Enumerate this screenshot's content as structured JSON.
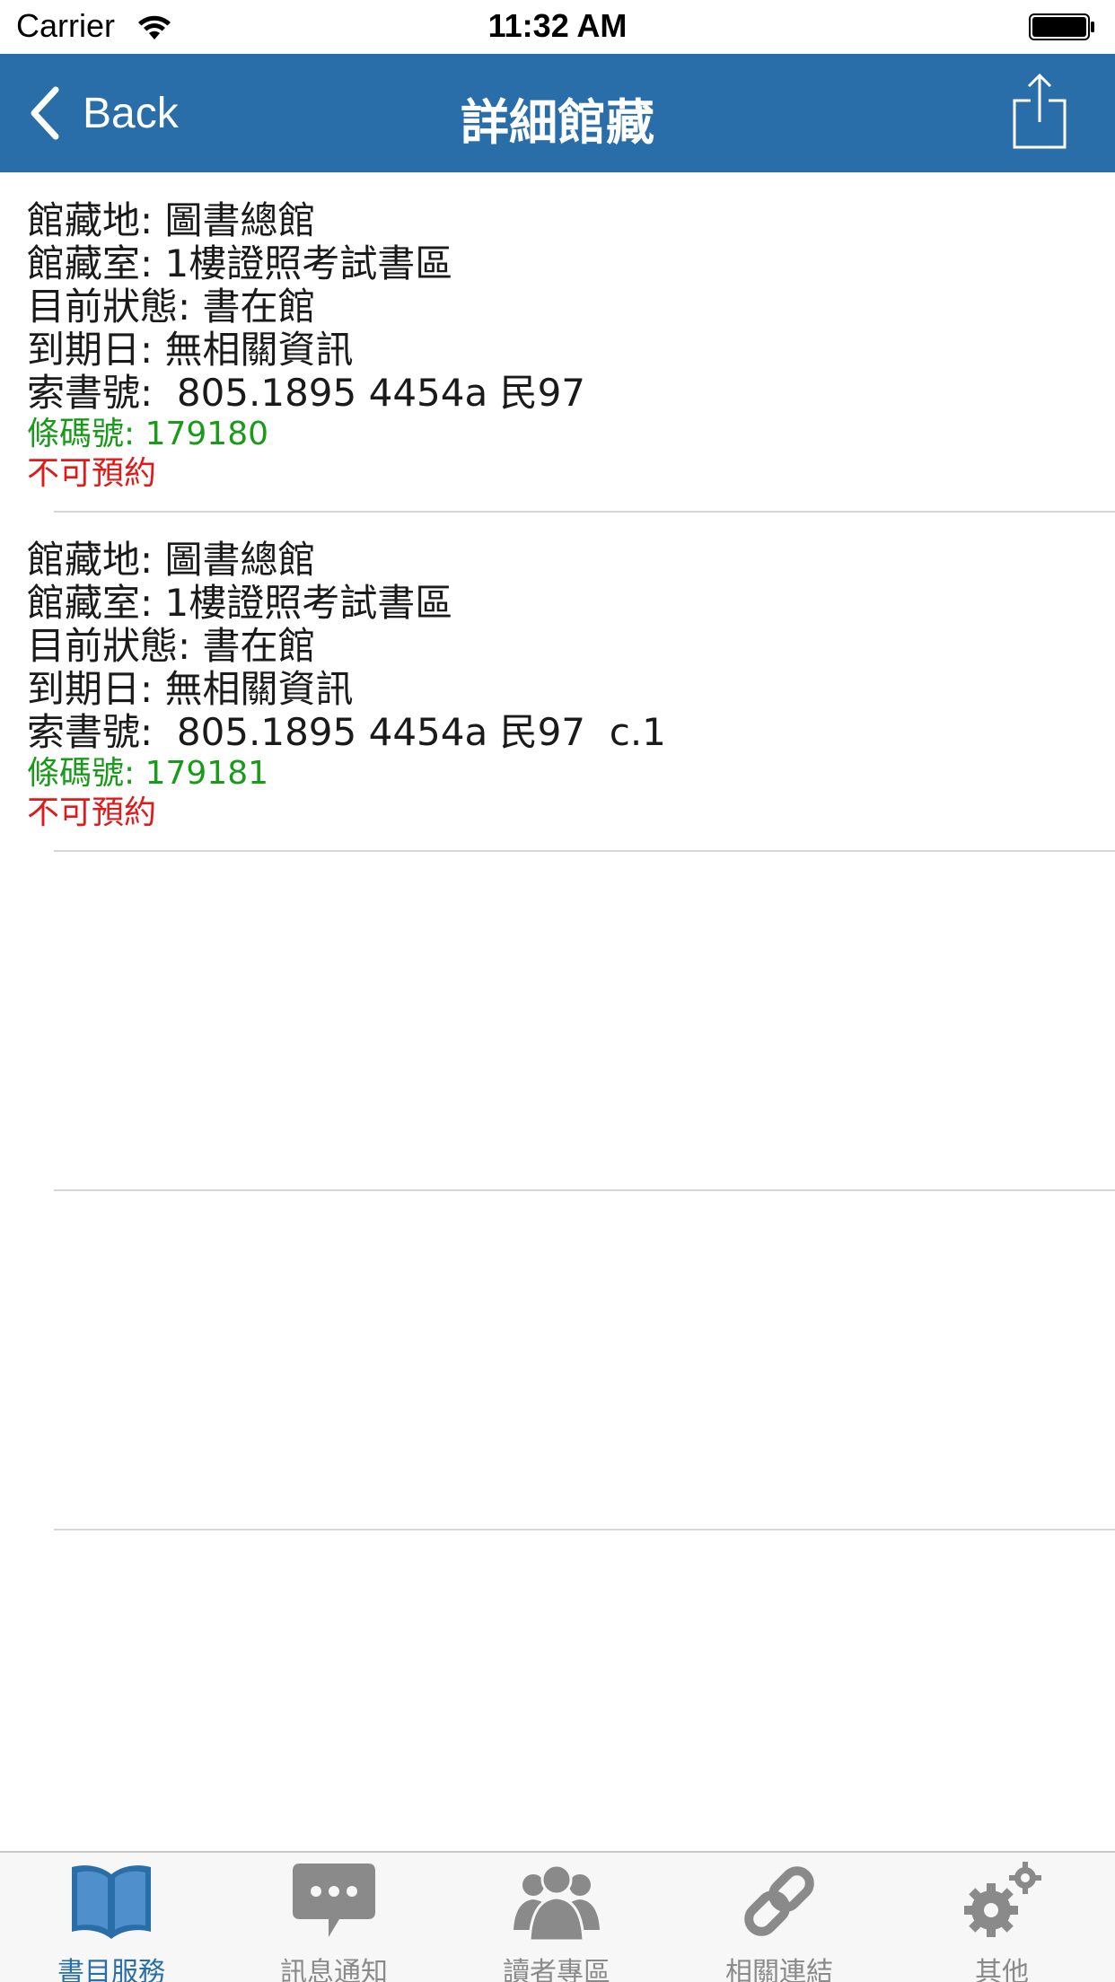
{
  "status_bar": {
    "carrier": "Carrier",
    "time": "11:32 AM"
  },
  "nav": {
    "back_label": "Back",
    "title": "詳細館藏"
  },
  "records": [
    {
      "location": "館藏地: 圖書總館",
      "room": "館藏室: 1樓證照考試書區",
      "status": "目前狀態: 書在館",
      "due": "到期日: 無相關資訊",
      "call_number": "索書號:  805.1895 4454a 民97",
      "barcode": "條碼號: 179180",
      "reservation": "不可預約"
    },
    {
      "location": "館藏地: 圖書總館",
      "room": "館藏室: 1樓證照考試書區",
      "status": "目前狀態: 書在館",
      "due": "到期日: 無相關資訊",
      "call_number": "索書號:  805.1895 4454a 民97  c.1",
      "barcode": "條碼號: 179181",
      "reservation": "不可預約"
    }
  ],
  "tabs": [
    {
      "label": "書目服務",
      "icon": "book-icon",
      "active": true
    },
    {
      "label": "訊息通知",
      "icon": "chat-bubble-icon",
      "active": false
    },
    {
      "label": "讀者專區",
      "icon": "users-icon",
      "active": false
    },
    {
      "label": "相關連結",
      "icon": "link-icon",
      "active": false
    },
    {
      "label": "其他",
      "icon": "gears-icon",
      "active": false
    }
  ],
  "colors": {
    "nav_background": "#2a6ea9",
    "barcode_text": "#1a9a1a",
    "reservation_text": "#e01a1a",
    "tab_active": "#2a6ea9",
    "tab_inactive": "#8a8a8a"
  }
}
